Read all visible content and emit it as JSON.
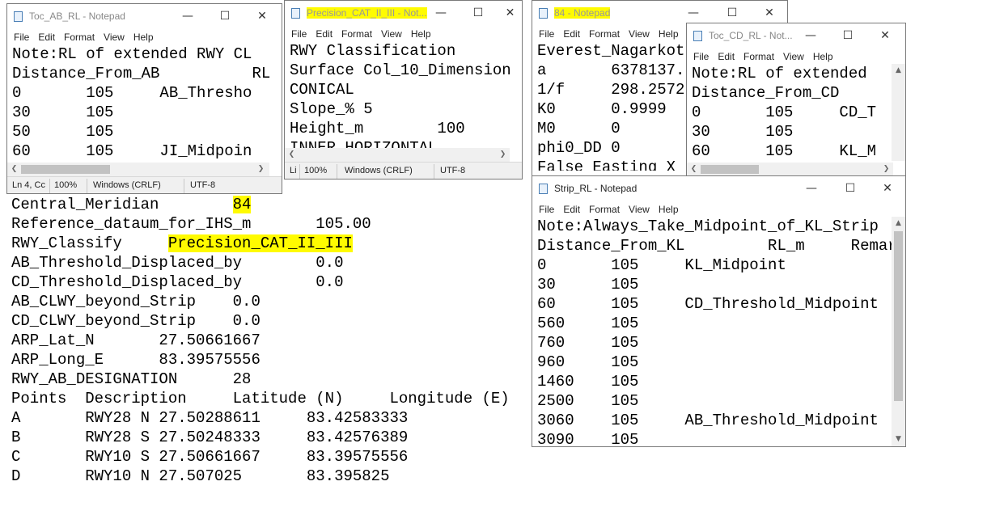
{
  "menu": [
    "File",
    "Edit",
    "Format",
    "View",
    "Help"
  ],
  "background_lines": [
    {
      "pre": "Central_Meridian        ",
      "hl": "84",
      "post": ""
    },
    {
      "pre": "Reference_dataum_for_IHS_m       105.00",
      "hl": "",
      "post": ""
    },
    {
      "pre": "RWY_Classify     ",
      "hl": "Precision_CAT_II_III",
      "post": ""
    },
    {
      "pre": "AB_Threshold_Displaced_by        0.0",
      "hl": "",
      "post": ""
    },
    {
      "pre": "CD_Threshold_Displaced_by        0.0",
      "hl": "",
      "post": ""
    },
    {
      "pre": "AB_CLWY_beyond_Strip    0.0",
      "hl": "",
      "post": ""
    },
    {
      "pre": "CD_CLWY_beyond_Strip    0.0",
      "hl": "",
      "post": ""
    },
    {
      "pre": "ARP_Lat_N       27.50661667",
      "hl": "",
      "post": ""
    },
    {
      "pre": "ARP_Long_E      83.39575556",
      "hl": "",
      "post": ""
    },
    {
      "pre": "RWY_AB_DESIGNATION      28",
      "hl": "",
      "post": ""
    },
    {
      "pre": "Points  Description     Latitude (N)     Longitude (E)",
      "hl": "",
      "post": ""
    },
    {
      "pre": "A       RWY28 N 27.50288611     83.42583333",
      "hl": "",
      "post": ""
    },
    {
      "pre": "B       RWY28 S 27.50248333     83.42576389",
      "hl": "",
      "post": ""
    },
    {
      "pre": "C       RWY10 S 27.50661667     83.39575556",
      "hl": "",
      "post": ""
    },
    {
      "pre": "D       RWY10 N 27.507025       83.395825",
      "hl": "",
      "post": ""
    }
  ],
  "win_toc_ab": {
    "title": "Toc_AB_RL - Notepad",
    "lines": [
      "Note:RL of extended RWY CL",
      "Distance_From_AB          RL",
      "0       105     AB_Thresho",
      "30      105",
      "50      105",
      "60      105     JI_Midpoin"
    ],
    "status": {
      "position": "Ln 4, Cc",
      "zoom": "100%",
      "eol": "Windows (CRLF)",
      "encoding": "UTF-8"
    }
  },
  "win_precision": {
    "title": "Precision_CAT_II_III - Not...",
    "lines": [
      "RWY Classification",
      "Surface Col_10_Dimension",
      "CONICAL",
      "Slope_% 5",
      "Height_m        100",
      "INNER HORIZONTAL"
    ],
    "status": {
      "position": "Li",
      "zoom": "100%",
      "eol": "Windows (CRLF)",
      "encoding": "UTF-8"
    }
  },
  "win_84": {
    "title": "84 - Notepad",
    "lines": [
      "Everest_Nagarkot",
      "a       6378137.",
      "1/f     298.2572",
      "K0      0.9999",
      "M0      0",
      "phi0_DD 0",
      "False Easting X"
    ]
  },
  "win_toc_cd": {
    "title": "Toc_CD_RL - Not...",
    "lines": [
      "Note:RL of extended",
      "Distance_From_CD",
      "0       105     CD_T",
      "30      105",
      "60      105     KL_M"
    ]
  },
  "win_strip": {
    "title": "Strip_RL - Notepad",
    "lines": [
      "Note:Always_Take_Midpoint_of_KL_Strip",
      "Distance_From_KL         RL_m     Remar",
      "0       105     KL_Midpoint",
      "30      105",
      "60      105     CD_Threshold_Midpoint",
      "560     105",
      "760     105",
      "960     105",
      "1460    105",
      "2500    105",
      "3060    105     AB_Threshold_Midpoint",
      "3090    105"
    ]
  }
}
